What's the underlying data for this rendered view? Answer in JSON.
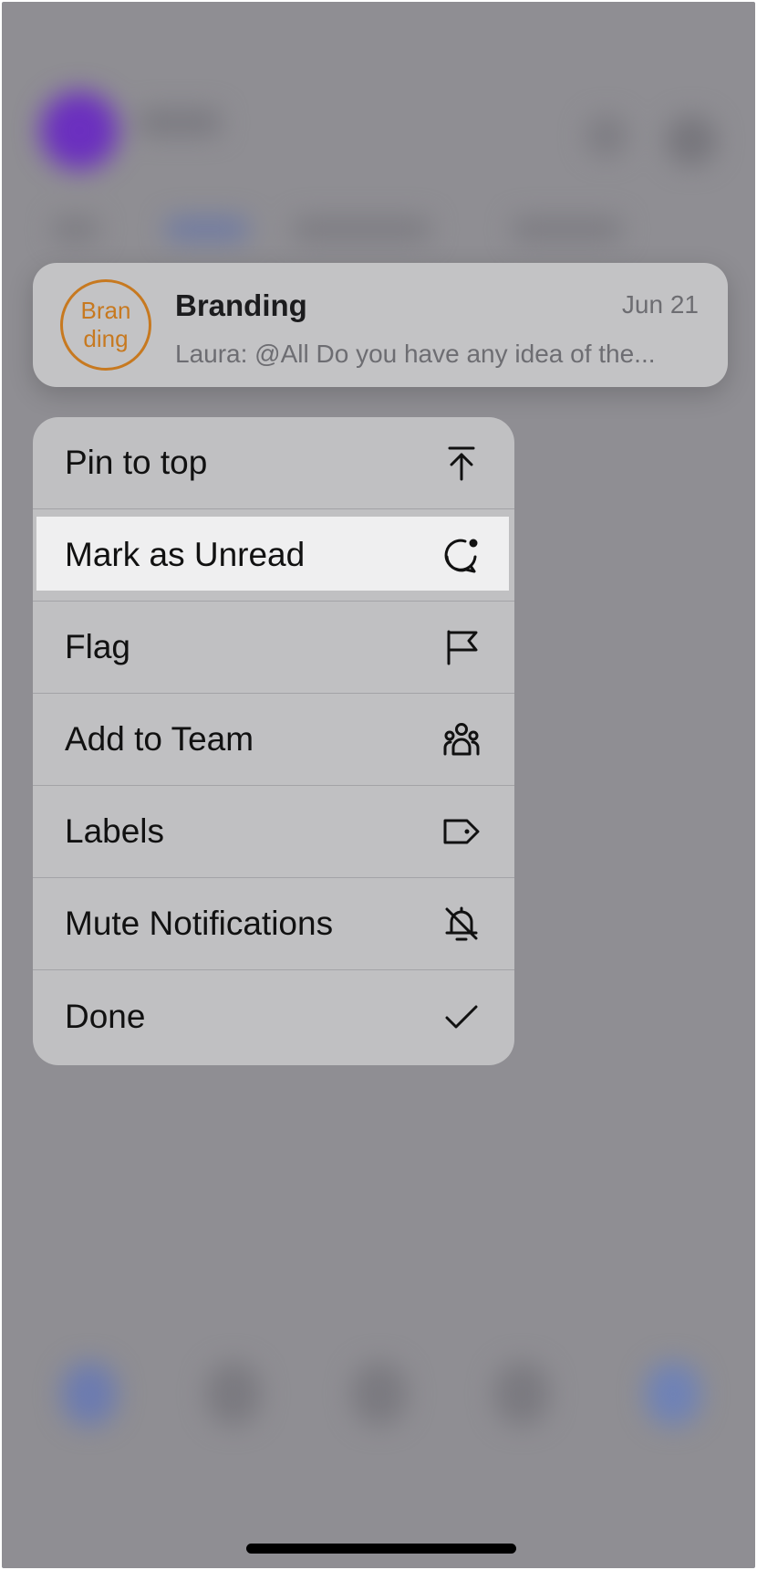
{
  "preview": {
    "avatar_line1": "Bran",
    "avatar_line2": "ding",
    "name": "Branding",
    "date": "Jun 21",
    "message": "Laura: @All Do you have any idea of the..."
  },
  "menu": {
    "items": [
      {
        "label": "Pin to top",
        "icon": "pin-to-top-icon"
      },
      {
        "label": "Mark as Unread",
        "icon": "mark-unread-icon",
        "highlighted": true
      },
      {
        "label": "Flag",
        "icon": "flag-icon"
      },
      {
        "label": "Add to Team",
        "icon": "team-icon"
      },
      {
        "label": "Labels",
        "icon": "label-tag-icon"
      },
      {
        "label": "Mute Notifications",
        "icon": "bell-off-icon"
      },
      {
        "label": "Done",
        "icon": "checkmark-icon"
      }
    ]
  },
  "colors": {
    "avatar_accent": "#c77920",
    "dim_background": "#8f8e93",
    "menu_background": "#c0c0c2",
    "highlight": "#efeff0"
  }
}
